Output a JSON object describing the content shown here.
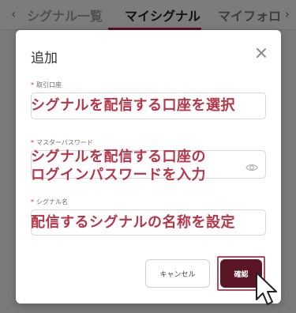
{
  "tabs": {
    "items": [
      {
        "label": "シグナル一覧"
      },
      {
        "label": "マイシグナル"
      },
      {
        "label": "マイフォロ"
      }
    ],
    "left_arrow": "‹",
    "right_arrow": "›",
    "active_color": "#5a1020"
  },
  "modal": {
    "title": "追加",
    "fields": [
      {
        "label": "取引口座",
        "value": "シグナルを配信する口座を選択"
      },
      {
        "label": "マスターパスワード",
        "value_line1": "シグナルを配信する口座の",
        "value_line2": "ログインパスワードを入力",
        "icon": "eye-icon"
      },
      {
        "label": "シグナル名",
        "value": "配信するシグナルの名称を設定"
      }
    ],
    "required_marker": "*",
    "cancel_label": "キャンセル",
    "confirm_label": "確認"
  },
  "colors": {
    "accent": "#5a1527",
    "annotation_text": "#b5374a",
    "highlight_frame": "#b24a5c"
  }
}
